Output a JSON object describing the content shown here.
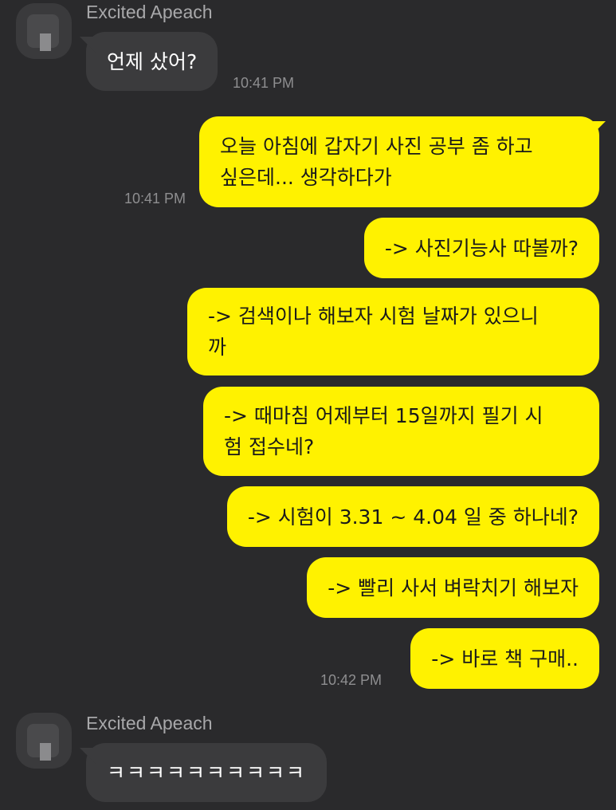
{
  "groups": [
    {
      "sender": "Excited Apeach",
      "messages": [
        {
          "text": "언제 샀어?",
          "time": "10:41 PM"
        }
      ]
    },
    {
      "sender": "me",
      "messages": [
        {
          "text": "오늘 아침에 갑자기 사진 공부 좀 하고\n싶은데... 생각하다가",
          "time": "10:41 PM"
        },
        {
          "text": "-> 사진기능사 따볼까?"
        },
        {
          "text": "-> 검색이나 해보자 시험 날짜가 있으니\n까"
        },
        {
          "text": "-> 때마침 어제부터 15일까지 필기 시\n험 접수네?"
        },
        {
          "text": "-> 시험이 3.31 ~ 4.04 일 중 하나네?"
        },
        {
          "text": "-> 빨리 사서 벼락치기 해보자"
        },
        {
          "text": "-> 바로 책 구매..",
          "time": "10:42 PM"
        }
      ]
    },
    {
      "sender": "Excited Apeach",
      "messages": [
        {
          "text": "ㅋㅋㅋㅋㅋㅋㅋㅋㅋㅋ"
        }
      ]
    }
  ]
}
